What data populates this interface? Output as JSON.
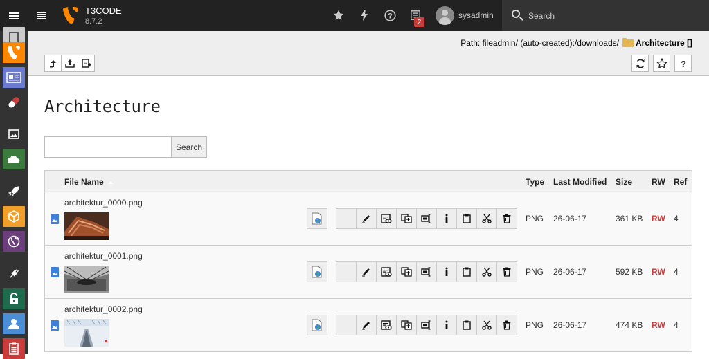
{
  "topbar": {
    "brand_name": "T3CODE",
    "version": "8.7.2",
    "notification_count": "2",
    "username": "sysadmin",
    "search_label": "Search"
  },
  "sidebar": {
    "modules": [
      {
        "icon": "page-icon",
        "color": "#cccccc"
      },
      {
        "icon": "typo3-icon",
        "color": "#ff8700"
      },
      {
        "icon": "list-view-icon",
        "color": "#6b7bd1"
      },
      {
        "icon": "capsule-icon",
        "color": "#333333"
      },
      {
        "icon": "image-icon",
        "color": "#333333"
      },
      {
        "icon": "cloud-icon",
        "color": "#3c7a3e"
      },
      {
        "icon": "rocket-icon",
        "color": "#333333"
      },
      {
        "icon": "box-icon",
        "color": "#f19f2a"
      },
      {
        "icon": "globe-icon",
        "color": "#6c3f7c"
      },
      {
        "icon": "plug-icon",
        "color": "#333333"
      },
      {
        "icon": "unlock-icon",
        "color": "#1e6b4d"
      },
      {
        "icon": "user-icon",
        "color": "#4b8ed6"
      },
      {
        "icon": "clipboard-icon",
        "color": "#c83c3c"
      }
    ]
  },
  "docheader": {
    "path_prefix": "Path: fileadmin/ (auto-created):/downloads/",
    "path_folder": "Architecture []"
  },
  "page": {
    "title": "Architecture",
    "search_button": "Search",
    "search_value": ""
  },
  "table": {
    "headers": {
      "name": "File Name",
      "type": "Type",
      "modified": "Last Modified",
      "size": "Size",
      "rw": "RW",
      "ref": "Ref"
    },
    "rows": [
      {
        "name": "architektur_0000.png",
        "type": "PNG",
        "modified": "26-06-17",
        "size": "361 KB",
        "rw": "RW",
        "ref": "4"
      },
      {
        "name": "architektur_0001.png",
        "type": "PNG",
        "modified": "26-06-17",
        "size": "592 KB",
        "rw": "RW",
        "ref": "4"
      },
      {
        "name": "architektur_0002.png",
        "type": "PNG",
        "modified": "26-06-17",
        "size": "474 KB",
        "rw": "RW",
        "ref": "4"
      }
    ]
  }
}
